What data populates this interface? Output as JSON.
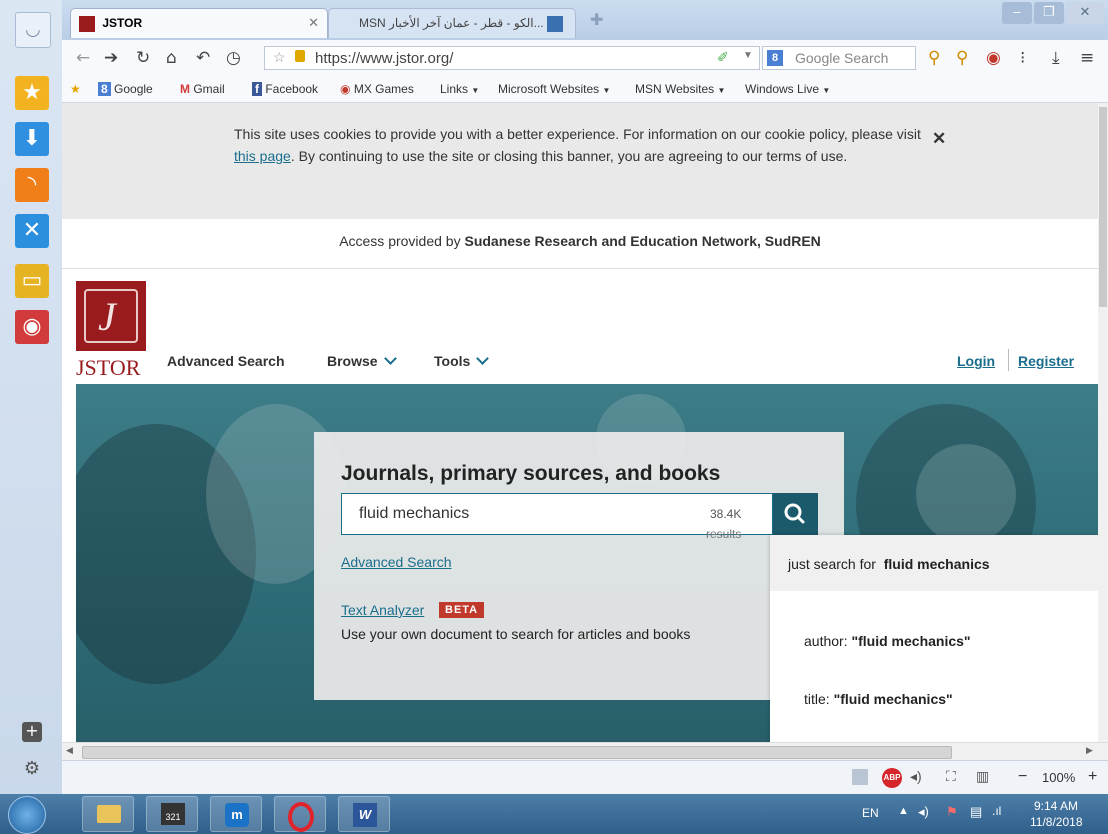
{
  "tabs": [
    {
      "label": "JSTOR",
      "active": true
    },
    {
      "label": "...الكو - قطر - عمان آخر الأخبار MSN",
      "active": false
    }
  ],
  "address": {
    "url": "https://www.jstor.org/",
    "search_placeholder": "Google Search"
  },
  "bookmarks": [
    "Google",
    "Gmail",
    "Facebook",
    "MX Games",
    "Links",
    "Microsoft Websites",
    "MSN Websites",
    "Windows Live"
  ],
  "cookie": {
    "text_before": "This site uses cookies to provide you with a better experience. For information on our cookie policy, please visit ",
    "link": "this page",
    "text_after": ". By continuing to use the site or closing this banner, you are agreeing to our terms of use.",
    "close": "✕"
  },
  "access": {
    "prefix": "Access provided by ",
    "org": "Sudanese Research and Education Network, SudREN"
  },
  "header": {
    "logo_text": "JSTOR",
    "nav": [
      "Advanced Search",
      "Browse",
      "Tools"
    ],
    "login": "Login",
    "register": "Register"
  },
  "search": {
    "title": "Journals, primary sources, and books",
    "query": "fluid mechanics",
    "count": "38.4K",
    "count_label": "results",
    "advanced_link": "Advanced Search",
    "text_analyzer": "Text Analyzer",
    "beta": "BETA",
    "analyzer_desc": "Use your own document to search for articles and books"
  },
  "suggestions": {
    "just_search_prefix": "just search for",
    "just_search_term": "fluid mechanics",
    "author_prefix": "author: ",
    "author_term": "\"fluid mechanics\"",
    "title_prefix": "title: ",
    "title_term": "\"fluid mechanics\""
  },
  "statusbar": {
    "zoom": "100%",
    "minus": "−",
    "plus": "+"
  },
  "taskbar": {
    "lang": "EN",
    "time": "9:14 AM",
    "date": "11/8/2018"
  },
  "colors": {
    "jstor_red": "#9a1b1e",
    "teal": "#1a6e8c",
    "beta_red": "#c0392b"
  }
}
